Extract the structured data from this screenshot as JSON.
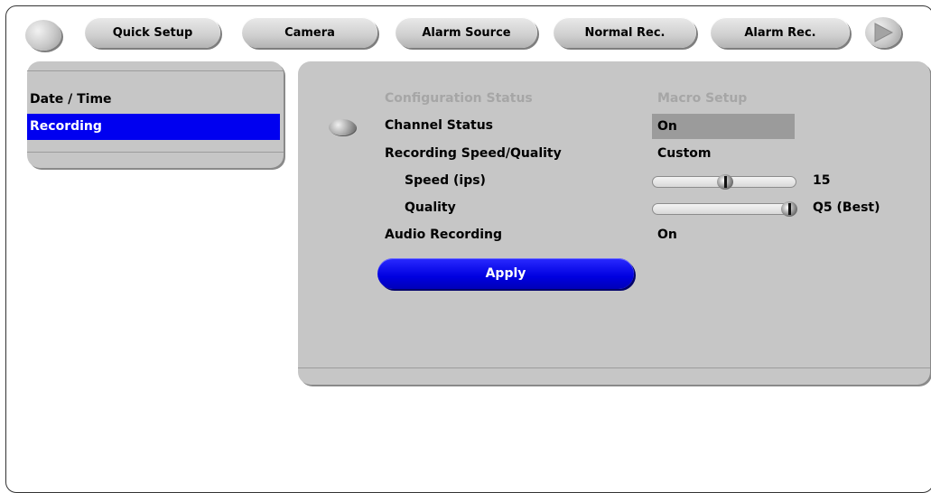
{
  "tabs": [
    {
      "label": "Quick Setup",
      "active": true
    },
    {
      "label": "Camera",
      "active": false
    },
    {
      "label": "Alarm Source",
      "active": false
    },
    {
      "label": "Normal Rec.",
      "active": false
    },
    {
      "label": "Alarm Rec.",
      "active": false
    }
  ],
  "nav_icons": {
    "left": "blank-round-button-icon",
    "right": "next-arrow-icon"
  },
  "sidebar": {
    "items": [
      {
        "label": "Date / Time",
        "selected": false
      },
      {
        "label": "Recording",
        "selected": true
      }
    ]
  },
  "form": {
    "header_left": "Configuration Status",
    "header_right": "Macro Setup",
    "channel_status_label": "Channel Status",
    "channel_status_value": "On",
    "speed_quality_label": "Recording Speed/Quality",
    "speed_quality_value": "Custom",
    "speed_label": "Speed (ips)",
    "speed_value": "15",
    "speed_fraction": 0.5,
    "quality_label": "Quality",
    "quality_value": "Q5 (Best)",
    "quality_fraction": 1.0,
    "audio_label": "Audio Recording",
    "audio_value": "On",
    "apply_label": "Apply"
  },
  "colors": {
    "accent": "#0000f0",
    "panel": "#c6c6c6",
    "highlight_box": "#9b9b9b"
  }
}
